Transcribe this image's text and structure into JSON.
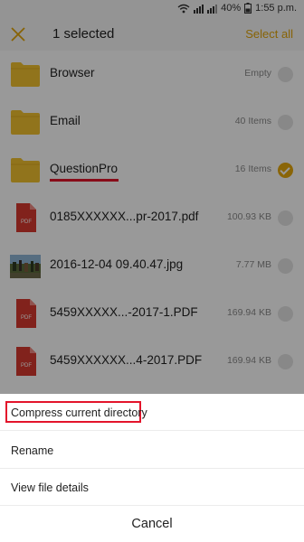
{
  "status_bar": {
    "battery": "40%",
    "time": "1:55 p.m."
  },
  "header": {
    "title": "1 selected",
    "select_all": "Select all"
  },
  "files": [
    {
      "name": "Browser",
      "meta": "Empty",
      "type": "folder",
      "selected": false
    },
    {
      "name": "Email",
      "meta": "40 Items",
      "type": "folder",
      "selected": false
    },
    {
      "name": "QuestionPro",
      "meta": "16 Items",
      "type": "folder",
      "selected": true
    },
    {
      "name": "0185XXXXXX...pr-2017.pdf",
      "meta": "100.93 KB",
      "type": "pdf",
      "selected": false
    },
    {
      "name": "2016-12-04 09.40.47.jpg",
      "meta": "7.77 MB",
      "type": "image",
      "selected": false
    },
    {
      "name": "5459XXXXX...-2017-1.PDF",
      "meta": "169.94 KB",
      "type": "pdf",
      "selected": false
    },
    {
      "name": "5459XXXXXX...4-2017.PDF",
      "meta": "169.94 KB",
      "type": "pdf",
      "selected": false
    }
  ],
  "bottom_sheet": {
    "compress": "Compress current directory",
    "rename": "Rename",
    "details": "View file details",
    "cancel": "Cancel"
  },
  "colors": {
    "accent": "#e7a80c",
    "highlight": "#e3142b",
    "folder": "#f2c230",
    "pdf": "#d83a2f"
  }
}
